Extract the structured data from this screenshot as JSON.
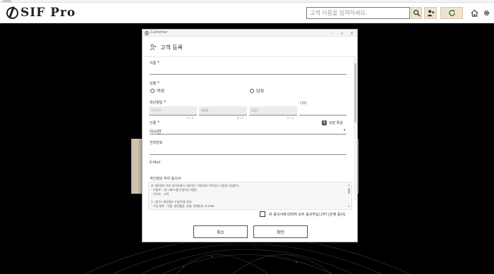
{
  "header": {
    "logo_text": "SIF Pro",
    "search_placeholder": "고객 이름을 입력하세요.",
    "icons": [
      "search-icon",
      "add-user-icon",
      "refresh-icon",
      "home-icon",
      "gear-icon"
    ]
  },
  "dialog": {
    "window_title": "Customer",
    "heading": "고객 등록",
    "fields": {
      "name_label": "이름",
      "gender_label": "성별",
      "gender_options": [
        "여성",
        "남성"
      ],
      "birth_label": "생년월일",
      "birth_year_placeholder": "YYYY",
      "birth_month_placeholder": "MM",
      "birth_day_placeholder": "DD",
      "year_counter": "0 / 4",
      "month_counter": "0 / 2",
      "day_counter": "0 / 2",
      "age_label": "나이",
      "race_label": "인종",
      "race_help": "모발 특징",
      "race_value": "아시안",
      "phone_label": "전화번호",
      "email_label": "E-Mail"
    },
    "consent": {
      "title": "개인정보 처리 동의서",
      "lines": [
        "본 개인정보 처리 동의서에서 사용하는 이용자와 수탁자는 다음을 지칭한다.",
        "- 이용자 : (본 서비스를 운영하는 매장)",
        "- 수탁자 : 고객",
        "1. (필수) 개인정보 수집/이용 동의",
        "- 수집 항목 : 이름, 생년월일, 성별, 전화번호, E-mail"
      ],
      "agree_label": "위 동의서에 대하여 모두 동의하십니까? [전체 동의]"
    },
    "buttons": {
      "cancel": "취소",
      "confirm": "확인"
    }
  },
  "colors": {
    "accent": "#efe3cf",
    "required": "#d63030"
  }
}
